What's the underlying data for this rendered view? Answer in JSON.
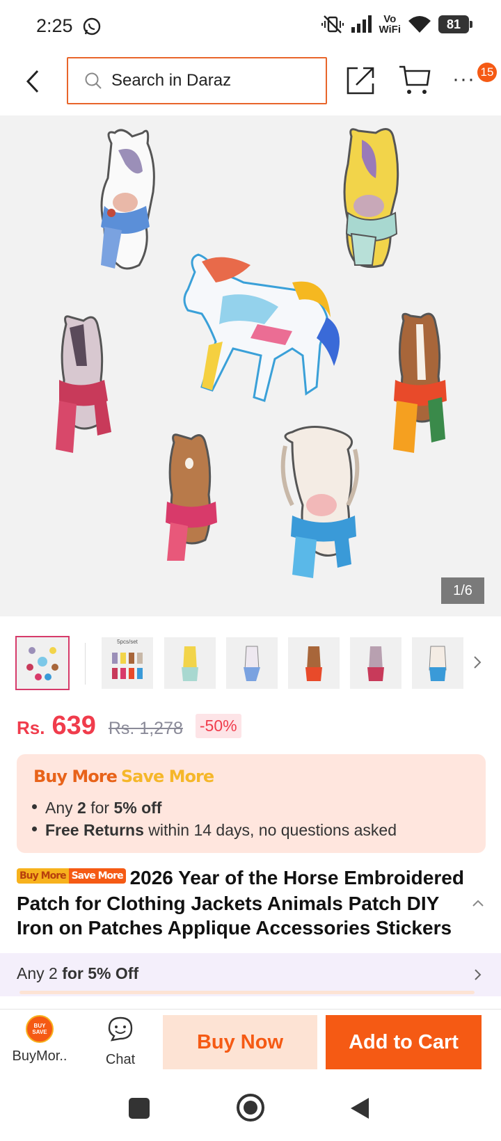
{
  "status": {
    "time": "2:25",
    "network_label_top": "Vo",
    "network_label_bottom": "WiFi",
    "battery": "81"
  },
  "header": {
    "search_placeholder": "Search in Daraz",
    "more_label": "···",
    "notification_count": "15"
  },
  "gallery": {
    "counter": "1/6",
    "thumb_caption": "5pcs/set"
  },
  "price": {
    "currency": "Rs.",
    "current": "639",
    "original": "Rs. 1,278",
    "discount": "-50%"
  },
  "promo": {
    "title_part1": "Buy More",
    "title_part2": "Save More",
    "line1_prefix": "Any ",
    "line1_qty": "2",
    "line1_mid": " for ",
    "line1_deal": "5% off",
    "line2_bold": "Free Returns",
    "line2_rest": " within 14 days, no questions asked"
  },
  "product": {
    "tag_part1": "Buy More",
    "tag_part2": "Save More",
    "title": "2026 Year of the Horse Embroidered Patch for Clothing Jackets Animals Patch DIY Iron on Patches Applique Accessories Stickers"
  },
  "offer": {
    "prefix": "Any 2 ",
    "bold": "for 5% Off",
    "progress": 0.0
  },
  "bottom": {
    "buymore_icon_line1": "BUY",
    "buymore_icon_line2": "SAVE",
    "buymore_label": "BuyMor..",
    "chat_label": "Chat",
    "buy_now": "Buy Now",
    "add_to_cart": "Add to Cart"
  },
  "colors": {
    "accent": "#f55a14",
    "price": "#f03c4c",
    "search_border": "#e8652a"
  }
}
